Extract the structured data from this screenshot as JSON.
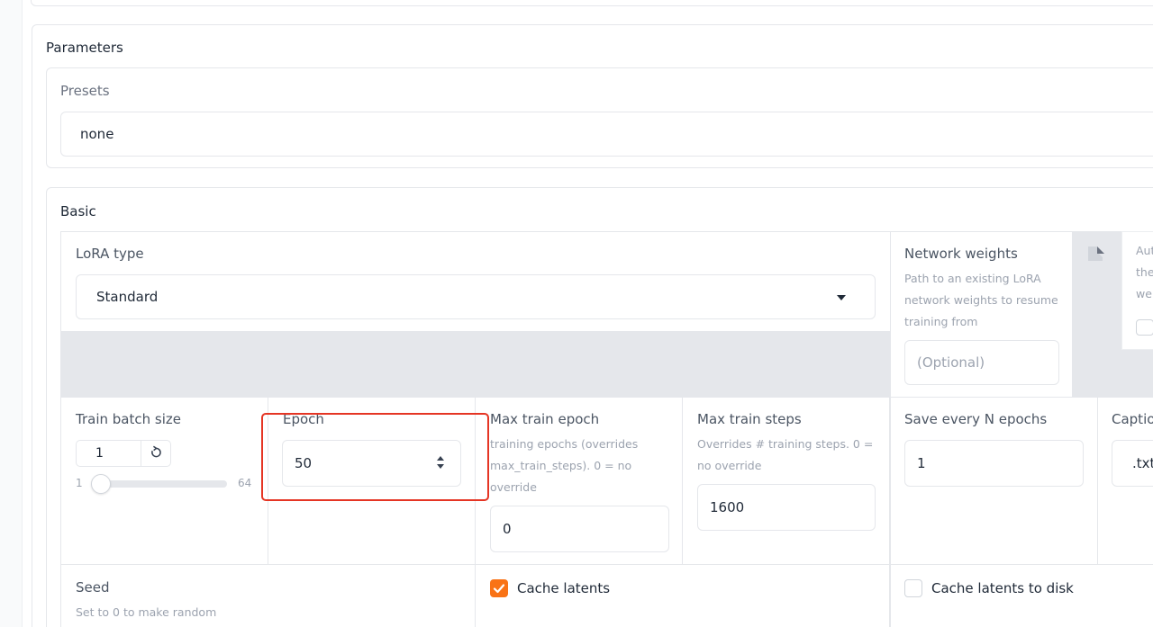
{
  "parameters": {
    "title": "Parameters",
    "presets": {
      "label": "Presets",
      "value": "none"
    },
    "basic": {
      "title": "Basic",
      "lora_type": {
        "label": "LoRA type",
        "value": "Standard"
      },
      "network_weights": {
        "label": "Network weights",
        "info": "Path to an existing LoRA network weights to resume training from",
        "placeholder": "(Optional)"
      },
      "auto_card": {
        "text": "Aut\nthe\nwe"
      },
      "train_batch_size": {
        "label": "Train batch size",
        "value": "1",
        "min": "1",
        "max": "64",
        "fill": 0.0
      },
      "epoch": {
        "label": "Epoch",
        "value": "50"
      },
      "max_train_epoch": {
        "label": "Max train epoch",
        "info": "training epochs (overrides max_train_steps). 0 = no override",
        "value": "0"
      },
      "max_train_steps": {
        "label": "Max train steps",
        "info": "Overrides # training steps. 0 = no override",
        "value": "1600"
      },
      "save_every_n_epochs": {
        "label": "Save every N epochs",
        "value": "1"
      },
      "caption": {
        "label": "Captio",
        "value": ".txt"
      },
      "seed": {
        "label": "Seed",
        "info": "Set to 0 to make random"
      },
      "cache_latents": {
        "label": "Cache latents",
        "checked": true
      },
      "cache_latents_to_disk": {
        "label": "Cache latents to disk",
        "checked": false
      }
    }
  },
  "colors": {
    "accent": "#f97316",
    "highlight": "#e53524"
  }
}
